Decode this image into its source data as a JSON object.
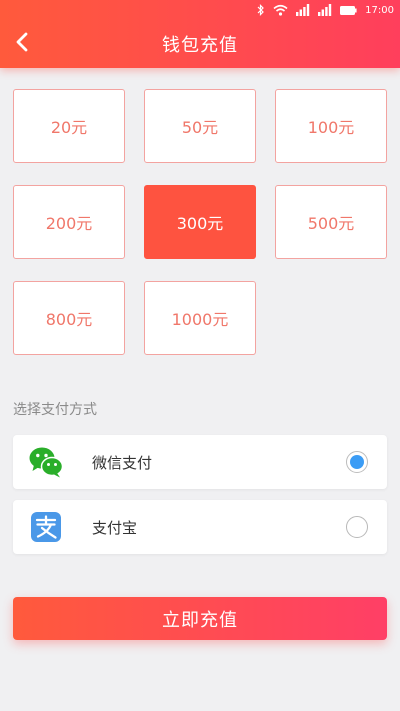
{
  "status_bar": {
    "time": "17:00",
    "icons": [
      "bluetooth-icon",
      "wifi-icon",
      "signal-icon",
      "signal-icon",
      "battery-icon"
    ]
  },
  "header": {
    "title": "钱包充值",
    "back_icon": "chevron-left-icon"
  },
  "amounts": [
    {
      "label": "20元",
      "selected": false
    },
    {
      "label": "50元",
      "selected": false
    },
    {
      "label": "100元",
      "selected": false
    },
    {
      "label": "200元",
      "selected": false
    },
    {
      "label": "300元",
      "selected": true
    },
    {
      "label": "500元",
      "selected": false
    },
    {
      "label": "800元",
      "selected": false
    },
    {
      "label": "1000元",
      "selected": false
    }
  ],
  "payment": {
    "section_title": "选择支付方式",
    "options": [
      {
        "label": "微信支付",
        "icon": "wechat-icon",
        "checked": true
      },
      {
        "label": "支付宝",
        "icon": "alipay-icon",
        "checked": false
      }
    ]
  },
  "submit_label": "立即充值",
  "colors": {
    "accent": "#fe5340",
    "accent_end": "#ff3f66",
    "amount_text": "#f0776a",
    "radio_checked": "#3b9cf5",
    "wechat_green": "#2aae2a",
    "alipay_blue": "#4a98e8"
  }
}
